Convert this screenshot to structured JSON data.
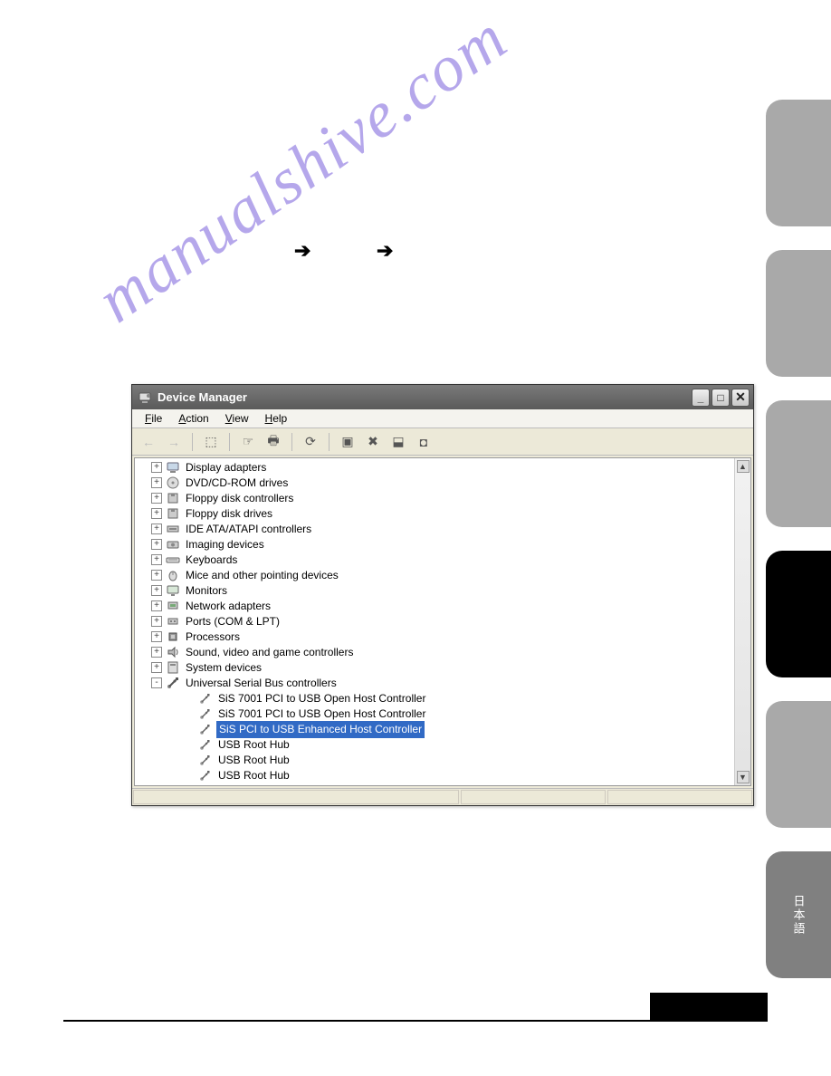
{
  "arrows": {
    "a1": "➔",
    "a2": "➔"
  },
  "watermark": "manualshive.com",
  "side_tab_text": "日本語",
  "window": {
    "title": "Device Manager",
    "title_icon": "device-manager-icon",
    "buttons": {
      "minimize": "_",
      "maximize": "□",
      "close": "✕"
    },
    "menus": {
      "file": "File",
      "file_ul": "F",
      "action": "Action",
      "action_ul": "A",
      "view": "View",
      "view_ul": "V",
      "help": "Help",
      "help_ul": "H"
    },
    "toolbar": {
      "back": "←",
      "forward": "→",
      "up": "⬚",
      "properties": "☞",
      "print": "🖶",
      "refresh": "⟳",
      "scan": "▣",
      "uninstall": "✖",
      "update": "⬓",
      "show": "◘"
    },
    "scroll": {
      "up": "▲",
      "down": "▼"
    }
  },
  "tree": [
    {
      "depth": 1,
      "twisty": "+",
      "icon": "display",
      "label": "Display adapters"
    },
    {
      "depth": 1,
      "twisty": "+",
      "icon": "dvd",
      "label": "DVD/CD-ROM drives"
    },
    {
      "depth": 1,
      "twisty": "+",
      "icon": "floppy",
      "label": "Floppy disk controllers"
    },
    {
      "depth": 1,
      "twisty": "+",
      "icon": "floppy",
      "label": "Floppy disk drives"
    },
    {
      "depth": 1,
      "twisty": "+",
      "icon": "ide",
      "label": "IDE ATA/ATAPI controllers"
    },
    {
      "depth": 1,
      "twisty": "+",
      "icon": "imaging",
      "label": "Imaging devices"
    },
    {
      "depth": 1,
      "twisty": "+",
      "icon": "keyboard",
      "label": "Keyboards"
    },
    {
      "depth": 1,
      "twisty": "+",
      "icon": "mouse",
      "label": "Mice and other pointing devices"
    },
    {
      "depth": 1,
      "twisty": "+",
      "icon": "monitor",
      "label": "Monitors"
    },
    {
      "depth": 1,
      "twisty": "+",
      "icon": "network",
      "label": "Network adapters"
    },
    {
      "depth": 1,
      "twisty": "+",
      "icon": "ports",
      "label": "Ports (COM & LPT)"
    },
    {
      "depth": 1,
      "twisty": "+",
      "icon": "processor",
      "label": "Processors"
    },
    {
      "depth": 1,
      "twisty": "+",
      "icon": "sound",
      "label": "Sound, video and game controllers"
    },
    {
      "depth": 1,
      "twisty": "+",
      "icon": "system",
      "label": "System devices"
    },
    {
      "depth": 1,
      "twisty": "-",
      "icon": "usb",
      "label": "Universal Serial Bus controllers"
    },
    {
      "depth": 2,
      "twisty": "",
      "icon": "usb-child",
      "label": "SiS 7001 PCI to USB Open Host Controller"
    },
    {
      "depth": 2,
      "twisty": "",
      "icon": "usb-child",
      "label": "SiS 7001 PCI to USB Open Host Controller"
    },
    {
      "depth": 2,
      "twisty": "",
      "icon": "usb-child",
      "label": "SiS PCI to USB Enhanced Host Controller",
      "selected": true
    },
    {
      "depth": 2,
      "twisty": "",
      "icon": "usb-child",
      "label": "USB Root Hub"
    },
    {
      "depth": 2,
      "twisty": "",
      "icon": "usb-child",
      "label": "USB Root Hub"
    },
    {
      "depth": 2,
      "twisty": "",
      "icon": "usb-child",
      "label": "USB Root Hub"
    }
  ]
}
